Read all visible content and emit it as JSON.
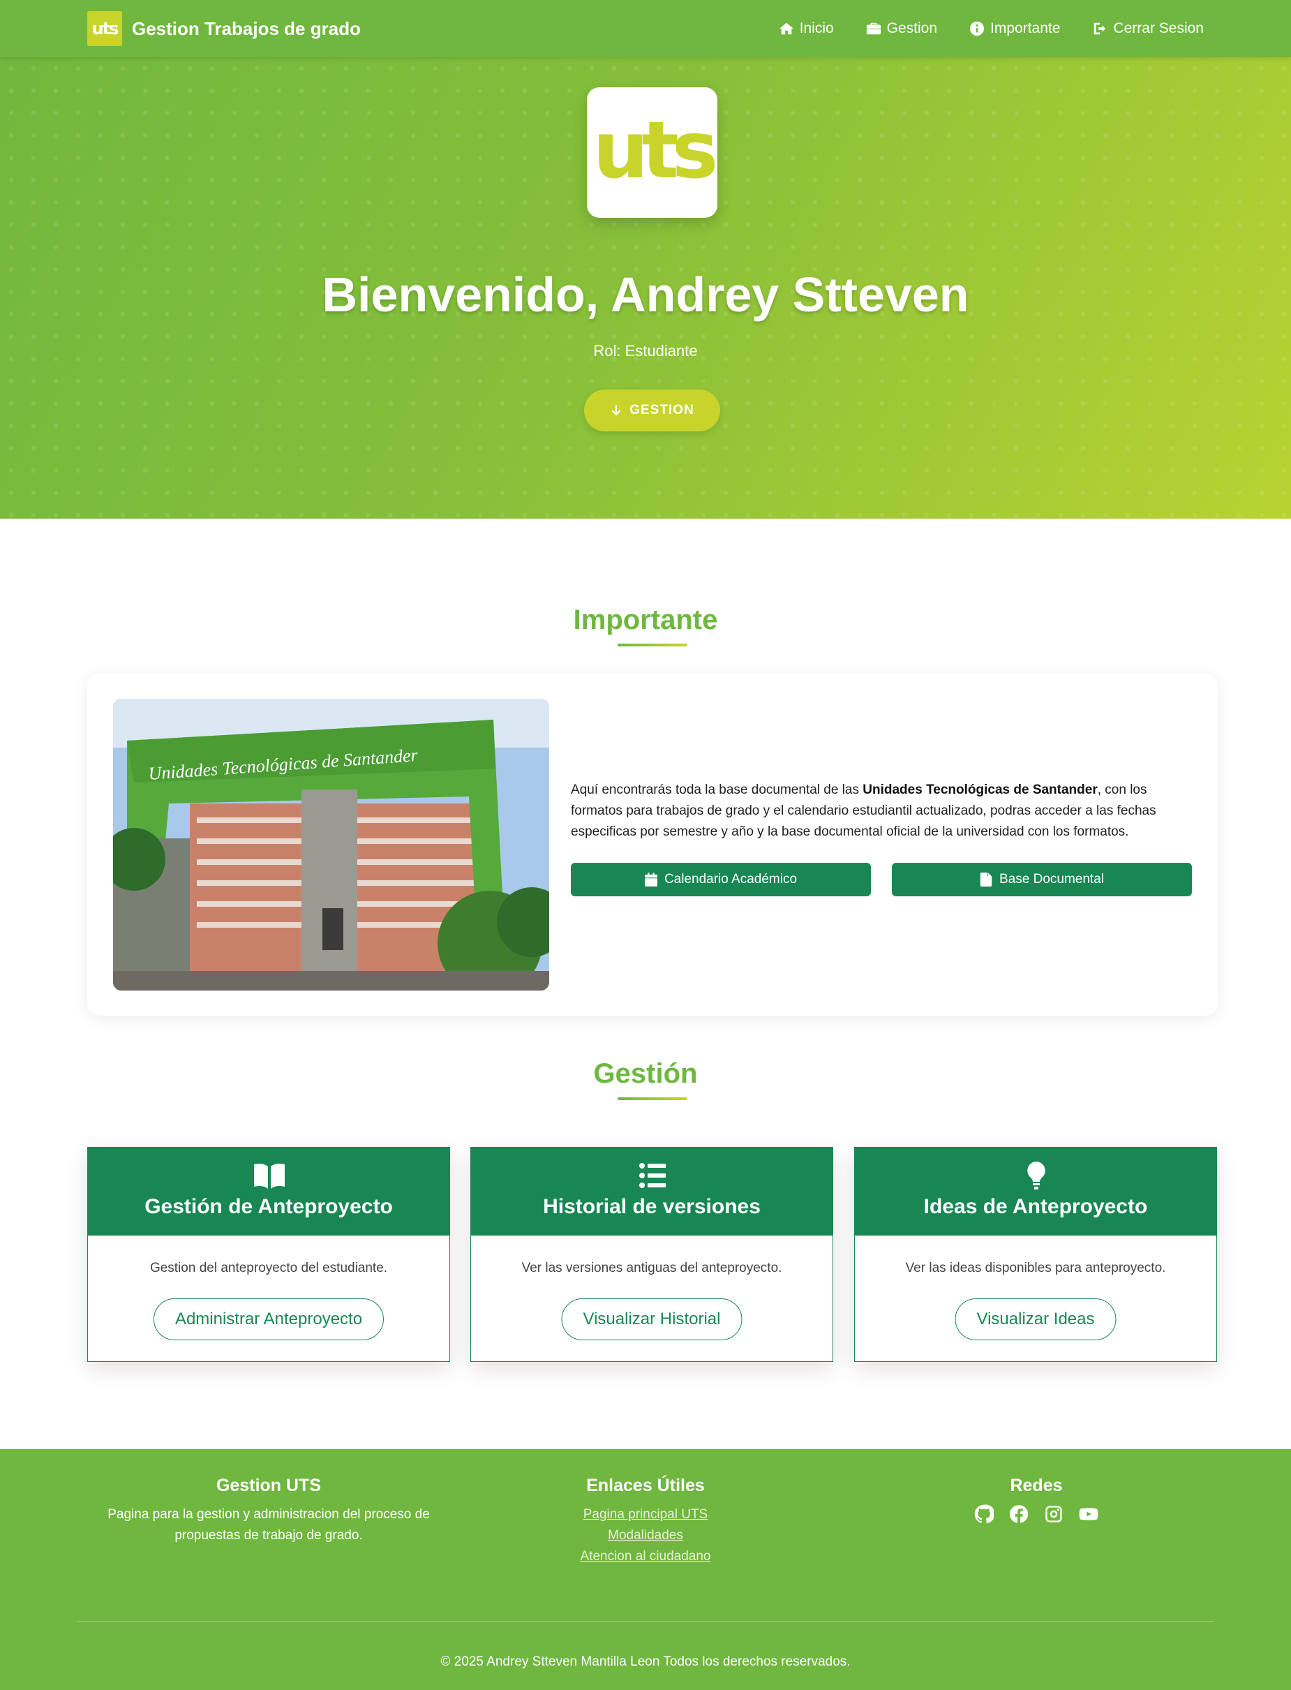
{
  "navbar": {
    "brand_logo": "uts",
    "brand_title": "Gestion Trabajos de grado",
    "links": [
      {
        "label": "Inicio",
        "icon": "home-icon"
      },
      {
        "label": "Gestion",
        "icon": "briefcase-icon"
      },
      {
        "label": "Importante",
        "icon": "info-circle-icon"
      },
      {
        "label": "Cerrar Sesion",
        "icon": "sign-out-icon"
      }
    ]
  },
  "hero": {
    "logo_text": "uts",
    "title": "Bienvenido, Andrey Stteven",
    "role": "Rol: Estudiante",
    "button_label": "GESTION"
  },
  "importante": {
    "title": "Importante",
    "photo_sign": "Unidades Tecnológicas de Santander",
    "text_before": "Aquí encontrarás toda la base documental de las ",
    "text_bold": "Unidades Tecnológicas de Santander",
    "text_after": ", con los formatos para trabajos de grado y el calendario estudiantil actualizado, podras acceder a las fechas especificas por semestre y año y la base documental oficial de la universidad con los formatos.",
    "buttons": [
      {
        "label": "Calendario Académico",
        "icon": "calendar-icon"
      },
      {
        "label": "Base Documental",
        "icon": "file-icon"
      }
    ]
  },
  "gestion": {
    "title": "Gestión",
    "cards": [
      {
        "title": "Gestión de Anteproyecto",
        "desc": "Gestion del anteproyecto del estudiante.",
        "button": "Administrar Anteproyecto",
        "icon": "book-open-icon"
      },
      {
        "title": "Historial de versiones",
        "desc": "Ver las versiones antiguas del anteproyecto.",
        "button": "Visualizar Historial",
        "icon": "list-icon"
      },
      {
        "title": "Ideas de Anteproyecto",
        "desc": "Ver las ideas disponibles para anteproyecto.",
        "button": "Visualizar Ideas",
        "icon": "lightbulb-icon"
      }
    ]
  },
  "footer": {
    "about_title": "Gestion UTS",
    "about_text": "Pagina para la gestion y administracion del proceso de propuestas de trabajo de grado.",
    "links_title": "Enlaces Útiles",
    "links": [
      "Pagina principal UTS",
      "Modalidades",
      "Atencion al ciudadano"
    ],
    "social_title": "Redes",
    "socials": [
      "github-icon",
      "facebook-icon",
      "instagram-icon",
      "youtube-icon"
    ],
    "copyright": "© 2025 Andrey Stteven Mantilla Leon Todos los derechos reservados."
  },
  "colors": {
    "primary_green": "#6fb73f",
    "lime": "#c8d42a",
    "dark_green": "#198754"
  }
}
